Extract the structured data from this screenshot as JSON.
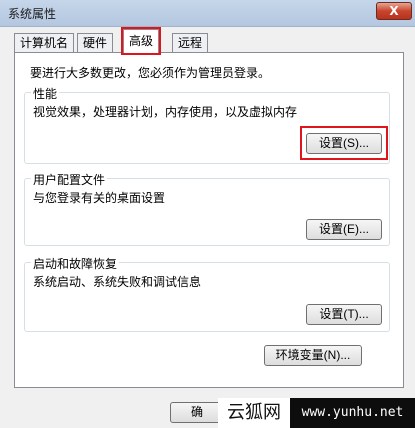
{
  "window": {
    "title": "系统属性",
    "close_label": "X"
  },
  "tabs": [
    {
      "label": "计算机名"
    },
    {
      "label": "硬件"
    },
    {
      "label": "高级"
    },
    {
      "label": "远程"
    }
  ],
  "notice": "要进行大多数更改，您必须作为管理员登录。",
  "performance": {
    "title": "性能",
    "description": "视觉效果，处理器计划，内存使用，以及虚拟内存",
    "button": "设置(S)..."
  },
  "user_profile": {
    "title": "用户配置文件",
    "description": "与您登录有关的桌面设置",
    "button": "设置(E)..."
  },
  "startup_recovery": {
    "title": "启动和故障恢复",
    "description": "系统启动、系统失败和调试信息",
    "button": "设置(T)..."
  },
  "env_button": "环境变量(N)...",
  "footer": {
    "ok_partial": "确"
  },
  "watermark": {
    "left": "云狐网",
    "right": "www.yunhu.net"
  }
}
